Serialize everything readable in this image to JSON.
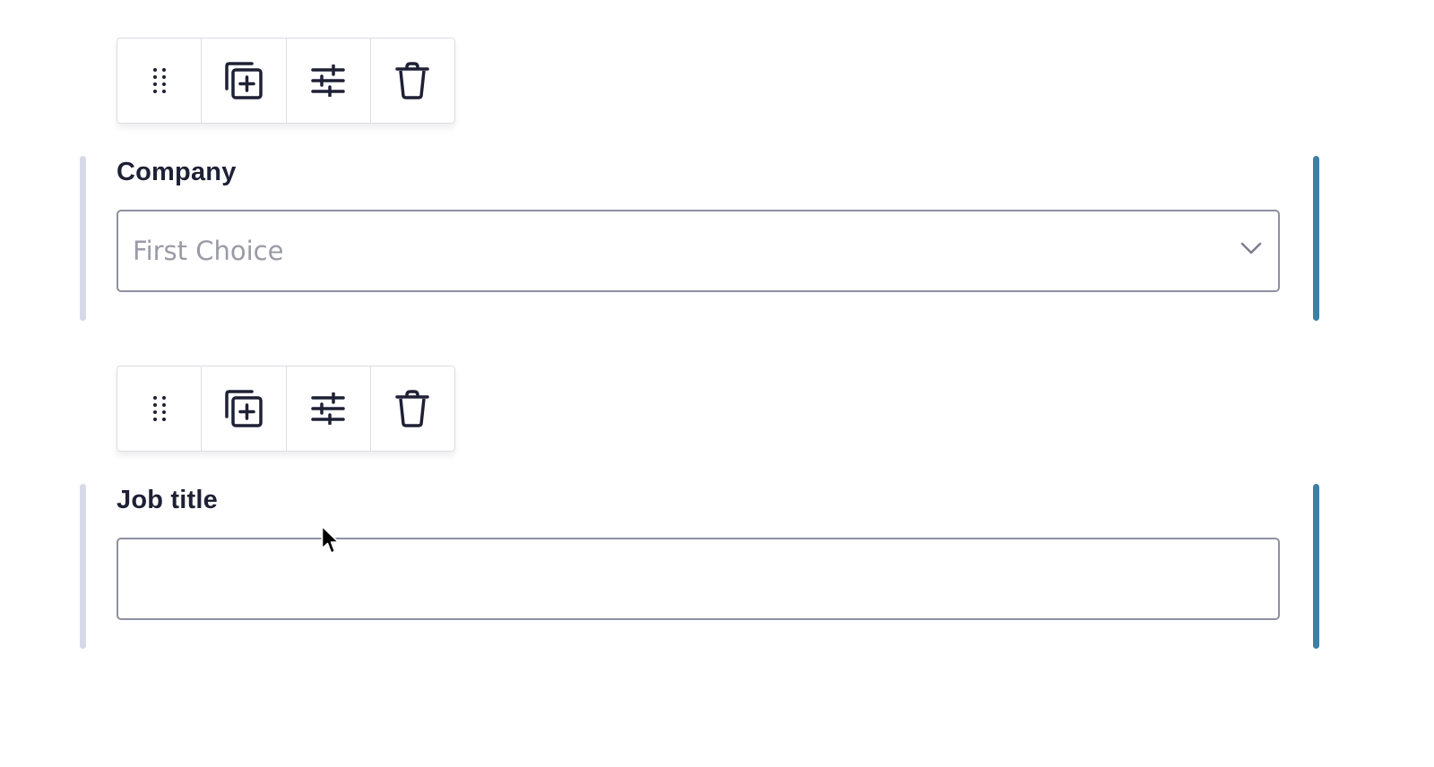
{
  "toolbar": {
    "drag_icon": "drag-handle-icon",
    "duplicate_icon": "duplicate-icon",
    "settings_icon": "sliders-icon",
    "delete_icon": "trash-icon"
  },
  "fields": [
    {
      "label": "Company",
      "type": "select",
      "selected_value": "First Choice"
    },
    {
      "label": "Job title",
      "type": "text",
      "value": ""
    }
  ],
  "colors": {
    "label_text": "#1e2035",
    "active_bar": "#3e7fa6",
    "inactive_bar": "#d6d9e6",
    "input_border": "#8e8fa2",
    "placeholder_text": "#9a9ba6"
  }
}
